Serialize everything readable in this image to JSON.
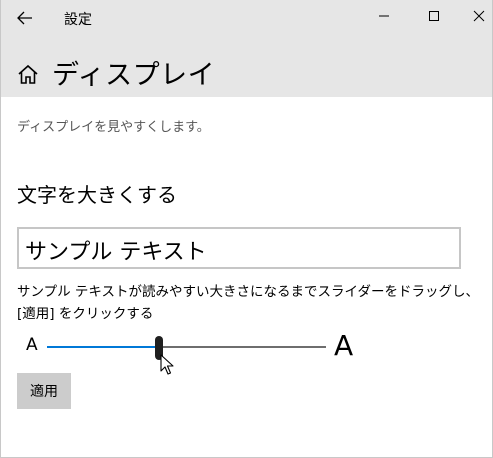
{
  "window": {
    "app_title": "設定",
    "back_icon": "back-arrow-icon",
    "minimize_icon": "minimize-icon",
    "maximize_icon": "maximize-icon",
    "close_icon": "close-icon"
  },
  "header": {
    "home_icon": "home-icon",
    "title": "ディスプレイ"
  },
  "main": {
    "description": "ディスプレイを見やすくします。",
    "section_title": "文字を大きくする",
    "sample_text": "サンプル テキスト",
    "instruction_line1": "サンプル テキストが読みやすい大きさになるまでスライダーをドラッグし、",
    "instruction_line2": "[適用] をクリックする",
    "slider": {
      "min_label": "A",
      "max_label": "A",
      "value_fraction": 0.4
    },
    "apply_button_label": "適用"
  },
  "colors": {
    "titlebar_bg": "#e6e6e6",
    "accent": "#0078d7",
    "button_bg": "#cccccc",
    "track": "#6e6e6e"
  }
}
